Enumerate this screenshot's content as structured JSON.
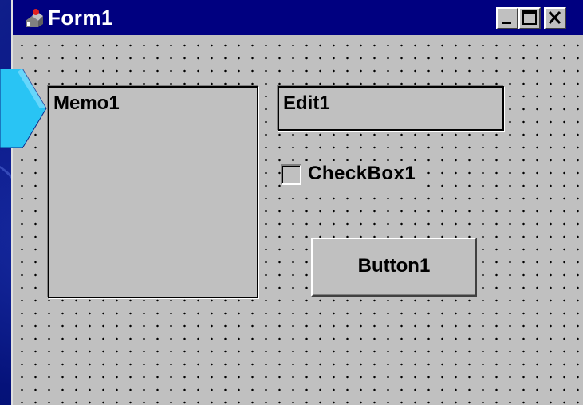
{
  "window": {
    "title": "Form1",
    "icon": "form-app-icon",
    "caption_buttons": [
      "minimize-icon",
      "maximize-icon",
      "close-icon"
    ],
    "titlebar_color": "#000080",
    "face_color": "#c0c0c0"
  },
  "form": {
    "memo": {
      "text": "Memo1"
    },
    "edit": {
      "value": "Edit1"
    },
    "checkbox": {
      "label": "CheckBox1",
      "checked": false
    },
    "button": {
      "label": "Button1"
    }
  },
  "background": {
    "color": "#000f6e",
    "pointer_color": "#29c4f4",
    "pointer_icon": "arrow-pointer-icon"
  }
}
